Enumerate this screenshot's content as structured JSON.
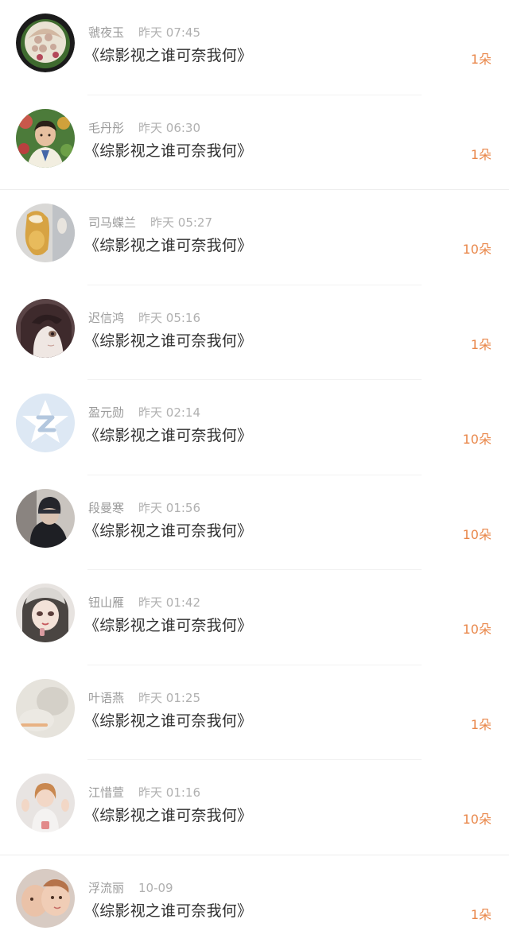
{
  "feed": {
    "items": [
      {
        "name": "虢夜玉",
        "time": "昨天 07:45",
        "title": "《综影视之谁可奈我何》",
        "gift": "1朵",
        "avatar": "watermelon-carving-avatar"
      },
      {
        "name": "毛丹彤",
        "time": "昨天 06:30",
        "title": "《综影视之谁可奈我何》",
        "gift": "1朵",
        "avatar": "child-photo-avatar"
      },
      {
        "name": "司马蝶兰",
        "time": "昨天 05:27",
        "title": "《综影视之谁可奈我何》",
        "gift": "10朵",
        "avatar": "drink-glass-avatar"
      },
      {
        "name": "迟信鸿",
        "time": "昨天 05:16",
        "title": "《综影视之谁可奈我何》",
        "gift": "1朵",
        "avatar": "anime-girl-avatar"
      },
      {
        "name": "盈元勋",
        "time": "昨天 02:14",
        "title": "《综影视之谁可奈我何》",
        "gift": "10朵",
        "avatar": "default-z-logo-avatar"
      },
      {
        "name": "段曼寒",
        "time": "昨天 01:56",
        "title": "《综影视之谁可奈我何》",
        "gift": "10朵",
        "avatar": "dark-beanie-avatar"
      },
      {
        "name": "钮山雁",
        "time": "昨天 01:42",
        "title": "《综影视之谁可奈我何》",
        "gift": "10朵",
        "avatar": "illustrated-girl-avatar"
      },
      {
        "name": "叶语燕",
        "time": "昨天 01:25",
        "title": "《综影视之谁可奈我何》",
        "gift": "1朵",
        "avatar": "pale-misty-avatar"
      },
      {
        "name": "江惜萱",
        "time": "昨天 01:16",
        "title": "《综影视之谁可奈我何》",
        "gift": "10朵",
        "avatar": "waving-girl-avatar"
      },
      {
        "name": "浮流丽",
        "time": "10-09",
        "title": "《综影视之谁可奈我何》",
        "gift": "1朵",
        "avatar": "kids-photo-avatar"
      }
    ]
  },
  "colors": {
    "gift_accent": "#e9874a",
    "name_text": "#9a9a9a",
    "title_text": "#2e2e2e",
    "divider": "#f1f1f1"
  }
}
